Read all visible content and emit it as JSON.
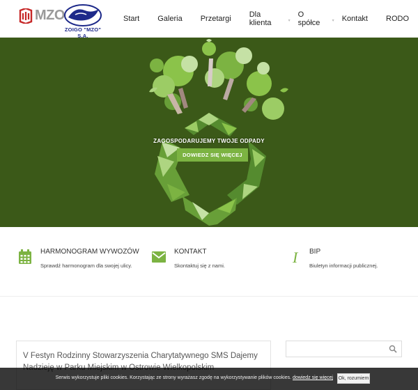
{
  "header": {
    "logo_text": "MZO",
    "partner_logo_caption": "ZOIGO \"MZO\" S.A.",
    "nav": [
      {
        "label": "Start",
        "has_dropdown": false
      },
      {
        "label": "Galeria",
        "has_dropdown": false
      },
      {
        "label": "Przetargi",
        "has_dropdown": false
      },
      {
        "label": "Dla klienta",
        "has_dropdown": true
      },
      {
        "label": "O spółce",
        "has_dropdown": true
      },
      {
        "label": "Kontakt",
        "has_dropdown": false
      },
      {
        "label": "RODO",
        "has_dropdown": false
      }
    ]
  },
  "hero": {
    "headline": "ZAGOSPODARUJEMY TWOJE ODPADY",
    "button_label": "DOWIEDZ SIĘ WIĘCEJ",
    "bg_color": "#3b5918",
    "accent_color": "#7cb342"
  },
  "features": [
    {
      "icon": "calendar-icon",
      "title": "HARMONOGRAM WYWOZÓW",
      "description": "Sprawdź harmonogram dla swojej ulicy."
    },
    {
      "icon": "envelope-icon",
      "title": "KONTAKT",
      "description": "Skontaktuj się z nami."
    },
    {
      "icon": "info-icon",
      "title": "BIP",
      "description": "Biuletyn informacji publicznej."
    }
  ],
  "post": {
    "title": "V Festyn Rodzinny Stowarzyszenia Charytatywnego SMS Dajemy Nadzieję w Parku Miejskim w Ostrowie Wielkopolskim"
  },
  "search": {
    "placeholder": "",
    "icon": "search-icon"
  },
  "cookie": {
    "text": "Serwis wykorzystuje pliki cookies. Korzystając ze strony wyrażasz zgodę na wykorzystywanie plików cookies.",
    "link": "dowiedz się więcej",
    "button": "Ok, rozumiem"
  }
}
